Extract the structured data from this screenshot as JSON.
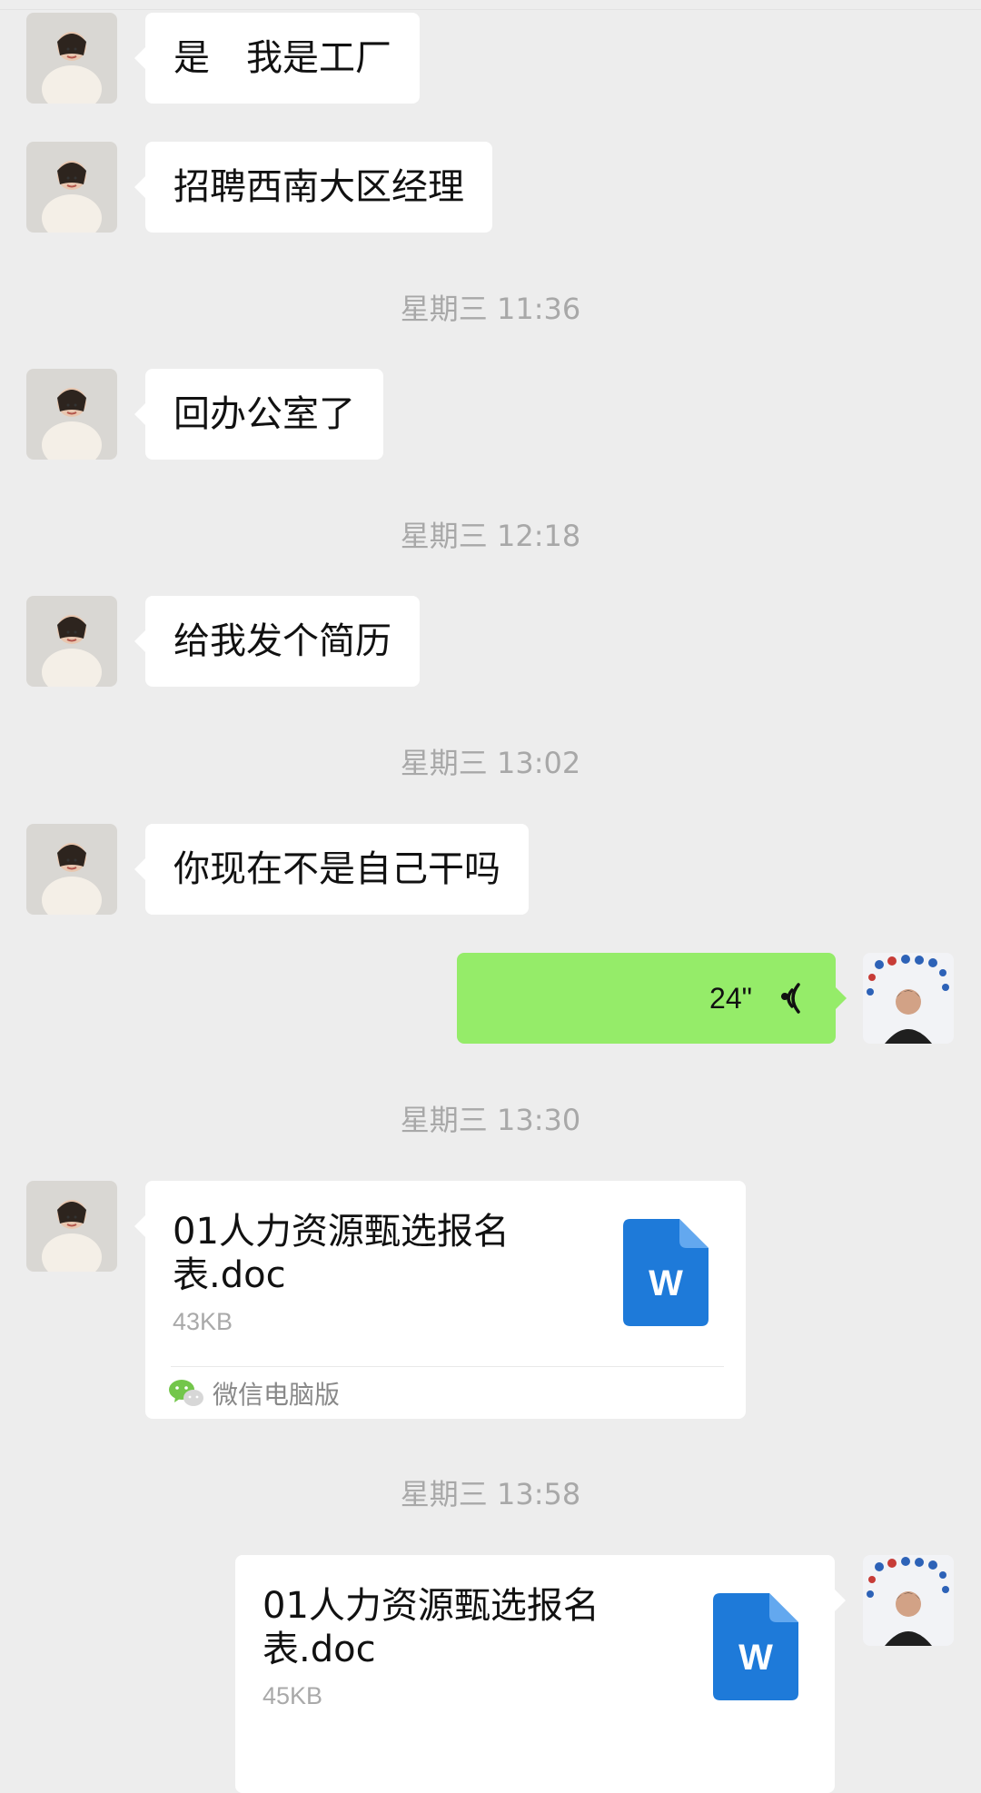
{
  "messages": [
    {
      "type": "text",
      "side": "left",
      "text": "是　我是工厂"
    },
    {
      "type": "text",
      "side": "left",
      "text": "招聘西南大区经理"
    },
    {
      "type": "time",
      "text": "星期三 11:36"
    },
    {
      "type": "text",
      "side": "left",
      "text": "回办公室了"
    },
    {
      "type": "time",
      "text": "星期三 12:18"
    },
    {
      "type": "text",
      "side": "left",
      "text": "给我发个简历"
    },
    {
      "type": "time",
      "text": "星期三 13:02"
    },
    {
      "type": "text",
      "side": "left",
      "text": "你现在不是自己干吗"
    },
    {
      "type": "voice",
      "side": "right",
      "duration": "24\""
    },
    {
      "type": "time",
      "text": "星期三 13:30"
    },
    {
      "type": "file",
      "side": "left",
      "name": "01人力资源甄选报名表.doc",
      "size": "43KB",
      "source": "微信电脑版",
      "icon": "word-doc-icon",
      "icon_letter": "W"
    },
    {
      "type": "time",
      "text": "星期三 13:58"
    },
    {
      "type": "file",
      "side": "right",
      "name": "01人力资源甄选报名表.doc",
      "size": "45KB",
      "icon": "word-doc-icon",
      "icon_letter": "W"
    }
  ],
  "colors": {
    "background": "#ededed",
    "incoming_bubble": "#ffffff",
    "outgoing_bubble": "#95ec69",
    "timestamp": "#a8a8a8",
    "word_icon": "#1e7ad9"
  }
}
